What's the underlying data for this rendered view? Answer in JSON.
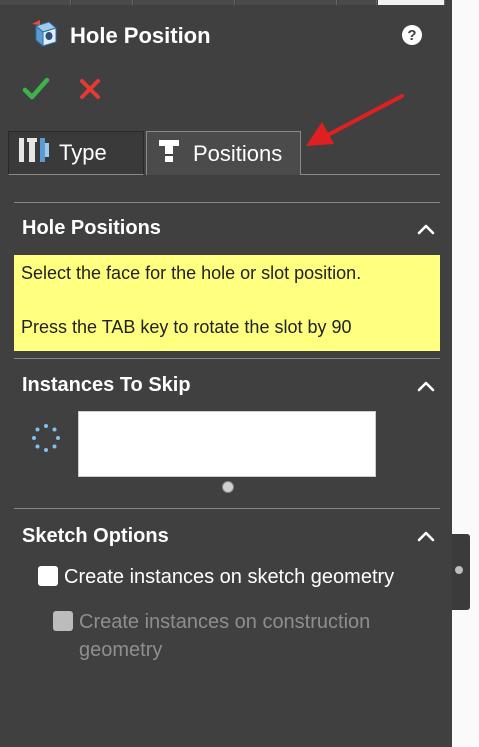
{
  "header": {
    "title": "Hole Position",
    "help_label": "?"
  },
  "tabs": {
    "type_label": "Type",
    "positions_label": "Positions"
  },
  "sections": {
    "hole_positions": {
      "title": "Hole Positions",
      "message_line1": "Select the face for the hole or slot position.",
      "message_line2": "Press the TAB key to rotate the slot by 90"
    },
    "instances_to_skip": {
      "title": "Instances To Skip"
    },
    "sketch_options": {
      "title": "Sketch Options",
      "opt1_label": "Create instances on sketch geometry",
      "opt2_label": "Create instances on construction geometry"
    }
  },
  "colors": {
    "panel_bg": "#404040",
    "info_bg": "#ffff80",
    "accept": "#3cb44b",
    "cancel": "#e53935",
    "annotation_arrow": "#e02020"
  }
}
